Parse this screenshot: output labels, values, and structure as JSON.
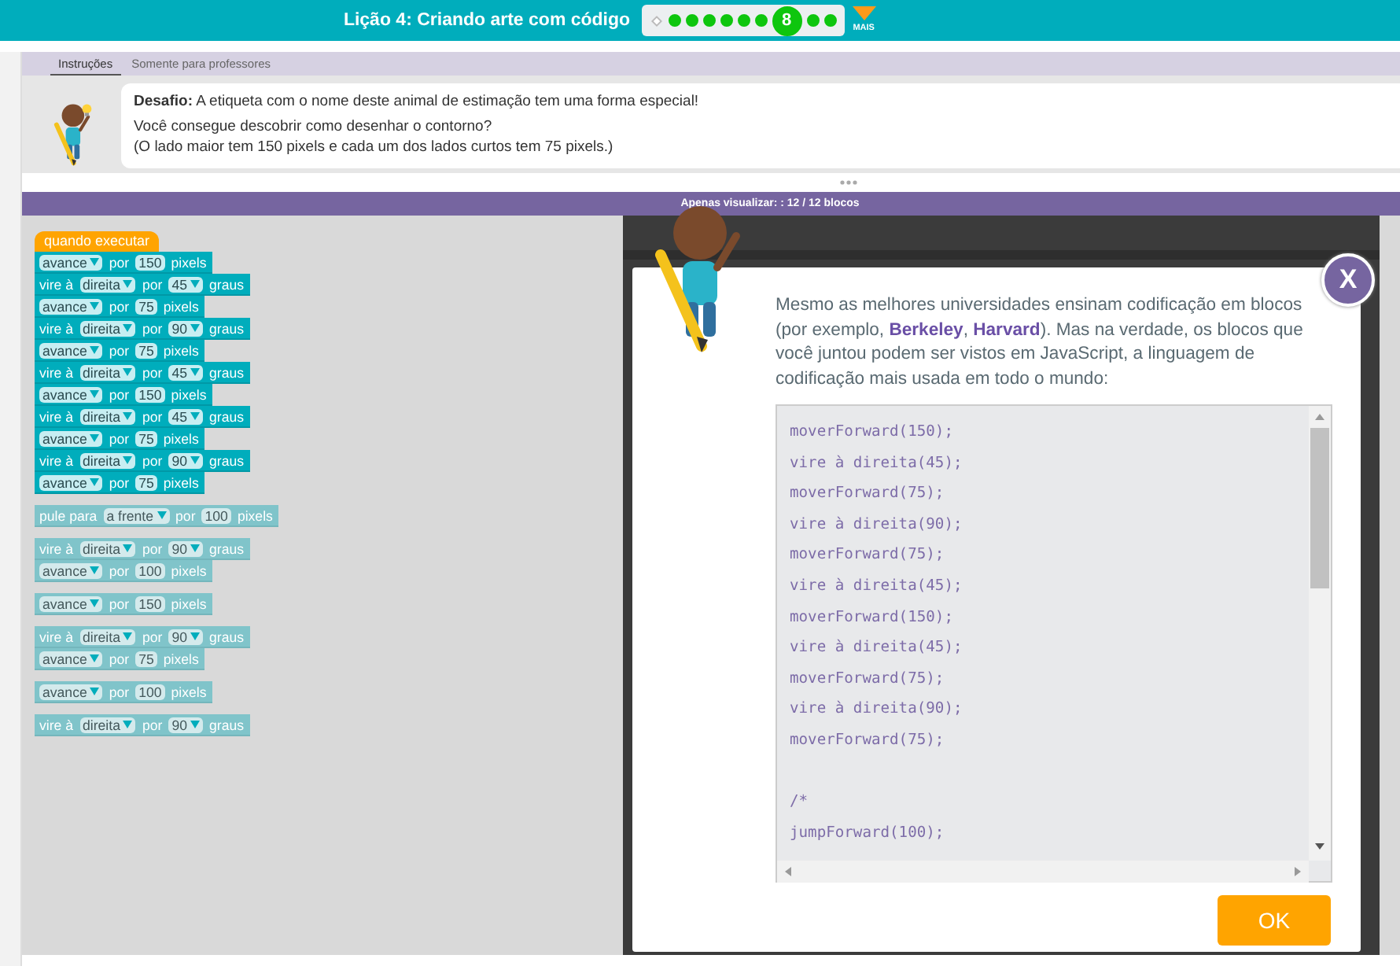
{
  "header": {
    "title": "Lição 4: Criando arte com código",
    "progress": [
      {
        "kind": "diamond",
        "completed": false,
        "selected": false
      },
      {
        "kind": "dot",
        "completed": true,
        "selected": false
      },
      {
        "kind": "dot",
        "completed": true,
        "selected": false
      },
      {
        "kind": "dot",
        "completed": true,
        "selected": false
      },
      {
        "kind": "dot",
        "completed": true,
        "selected": false
      },
      {
        "kind": "dot",
        "completed": true,
        "selected": false
      },
      {
        "kind": "dot",
        "completed": true,
        "selected": false
      },
      {
        "kind": "dot",
        "completed": true,
        "selected": true,
        "label": "8"
      },
      {
        "kind": "dot",
        "completed": true,
        "selected": false
      },
      {
        "kind": "dot",
        "completed": true,
        "selected": false
      }
    ],
    "more_label": "MAIS"
  },
  "instructions": {
    "tabs": [
      {
        "label": "Instruções",
        "selected": true
      },
      {
        "label": "Somente para professores",
        "selected": false
      }
    ],
    "challenge": "**Desafio:** A etiqueta com o nome deste animal de estimação tem uma forma especial!",
    "lines": [
      "Você consegue descobrir como desenhar o contorno?",
      "(O lado maior tem 150 pixels e cada um dos lados curtos tem 75 pixels.)"
    ]
  },
  "workspace_bar": {
    "text": "Apenas visualizar: : 12 / 12 blocos"
  },
  "workspace": {
    "stacks": [
      {
        "enabled": true,
        "hat": "quando executar",
        "blocks": [
          {
            "parts": [
              {
                "kind": "dropdown",
                "text": "avance"
              },
              {
                "kind": "text",
                "text": "por"
              },
              {
                "kind": "number",
                "text": "150"
              },
              {
                "kind": "text",
                "text": "pixels"
              }
            ]
          },
          {
            "parts": [
              {
                "kind": "text",
                "text": "vire à"
              },
              {
                "kind": "dropdown",
                "text": "direita"
              },
              {
                "kind": "text",
                "text": "por"
              },
              {
                "kind": "dropdown",
                "text": "45"
              },
              {
                "kind": "text",
                "text": "graus"
              }
            ]
          },
          {
            "parts": [
              {
                "kind": "dropdown",
                "text": "avance"
              },
              {
                "kind": "text",
                "text": "por"
              },
              {
                "kind": "number",
                "text": "75"
              },
              {
                "kind": "text",
                "text": "pixels"
              }
            ]
          },
          {
            "parts": [
              {
                "kind": "text",
                "text": "vire à"
              },
              {
                "kind": "dropdown",
                "text": "direita"
              },
              {
                "kind": "text",
                "text": "por"
              },
              {
                "kind": "dropdown",
                "text": "90"
              },
              {
                "kind": "text",
                "text": "graus"
              }
            ]
          },
          {
            "parts": [
              {
                "kind": "dropdown",
                "text": "avance"
              },
              {
                "kind": "text",
                "text": "por"
              },
              {
                "kind": "number",
                "text": "75"
              },
              {
                "kind": "text",
                "text": "pixels"
              }
            ]
          },
          {
            "parts": [
              {
                "kind": "text",
                "text": "vire à"
              },
              {
                "kind": "dropdown",
                "text": "direita"
              },
              {
                "kind": "text",
                "text": "por"
              },
              {
                "kind": "dropdown",
                "text": "45"
              },
              {
                "kind": "text",
                "text": "graus"
              }
            ]
          },
          {
            "parts": [
              {
                "kind": "dropdown",
                "text": "avance"
              },
              {
                "kind": "text",
                "text": "por"
              },
              {
                "kind": "number",
                "text": "150"
              },
              {
                "kind": "text",
                "text": "pixels"
              }
            ]
          },
          {
            "parts": [
              {
                "kind": "text",
                "text": "vire à"
              },
              {
                "kind": "dropdown",
                "text": "direita"
              },
              {
                "kind": "text",
                "text": "por"
              },
              {
                "kind": "dropdown",
                "text": "45"
              },
              {
                "kind": "text",
                "text": "graus"
              }
            ]
          },
          {
            "parts": [
              {
                "kind": "dropdown",
                "text": "avance"
              },
              {
                "kind": "text",
                "text": "por"
              },
              {
                "kind": "number",
                "text": "75"
              },
              {
                "kind": "text",
                "text": "pixels"
              }
            ]
          },
          {
            "parts": [
              {
                "kind": "text",
                "text": "vire à"
              },
              {
                "kind": "dropdown",
                "text": "direita"
              },
              {
                "kind": "text",
                "text": "por"
              },
              {
                "kind": "dropdown",
                "text": "90"
              },
              {
                "kind": "text",
                "text": "graus"
              }
            ]
          },
          {
            "parts": [
              {
                "kind": "dropdown",
                "text": "avance"
              },
              {
                "kind": "text",
                "text": "por"
              },
              {
                "kind": "number",
                "text": "75"
              },
              {
                "kind": "text",
                "text": "pixels"
              }
            ]
          }
        ]
      },
      {
        "enabled": false,
        "blocks": [
          {
            "parts": [
              {
                "kind": "text",
                "text": "pule para"
              },
              {
                "kind": "dropdown",
                "text": "a frente"
              },
              {
                "kind": "text",
                "text": "por"
              },
              {
                "kind": "number",
                "text": "100"
              },
              {
                "kind": "text",
                "text": "pixels"
              }
            ]
          }
        ]
      },
      {
        "enabled": false,
        "blocks": [
          {
            "parts": [
              {
                "kind": "text",
                "text": "vire à"
              },
              {
                "kind": "dropdown",
                "text": "direita"
              },
              {
                "kind": "text",
                "text": "por"
              },
              {
                "kind": "dropdown",
                "text": "90"
              },
              {
                "kind": "text",
                "text": "graus"
              }
            ]
          },
          {
            "parts": [
              {
                "kind": "dropdown",
                "text": "avance"
              },
              {
                "kind": "text",
                "text": "por"
              },
              {
                "kind": "number",
                "text": "100"
              },
              {
                "kind": "text",
                "text": "pixels"
              }
            ]
          }
        ]
      },
      {
        "enabled": false,
        "blocks": [
          {
            "parts": [
              {
                "kind": "dropdown",
                "text": "avance"
              },
              {
                "kind": "text",
                "text": "por"
              },
              {
                "kind": "number",
                "text": "150"
              },
              {
                "kind": "text",
                "text": "pixels"
              }
            ]
          }
        ]
      },
      {
        "enabled": false,
        "blocks": [
          {
            "parts": [
              {
                "kind": "text",
                "text": "vire à"
              },
              {
                "kind": "dropdown",
                "text": "direita"
              },
              {
                "kind": "text",
                "text": "por"
              },
              {
                "kind": "dropdown",
                "text": "90"
              },
              {
                "kind": "text",
                "text": "graus"
              }
            ]
          },
          {
            "parts": [
              {
                "kind": "dropdown",
                "text": "avance"
              },
              {
                "kind": "text",
                "text": "por"
              },
              {
                "kind": "number",
                "text": "75"
              },
              {
                "kind": "text",
                "text": "pixels"
              }
            ]
          }
        ]
      },
      {
        "enabled": false,
        "blocks": [
          {
            "parts": [
              {
                "kind": "dropdown",
                "text": "avance"
              },
              {
                "kind": "text",
                "text": "por"
              },
              {
                "kind": "number",
                "text": "100"
              },
              {
                "kind": "text",
                "text": "pixels"
              }
            ]
          }
        ]
      },
      {
        "enabled": false,
        "blocks": [
          {
            "parts": [
              {
                "kind": "text",
                "text": "vire à"
              },
              {
                "kind": "dropdown",
                "text": "direita"
              },
              {
                "kind": "text",
                "text": "por"
              },
              {
                "kind": "dropdown",
                "text": "90"
              },
              {
                "kind": "text",
                "text": "graus"
              }
            ]
          }
        ]
      }
    ]
  },
  "dialog": {
    "close_button": "X",
    "message": [
      {
        "kind": "text",
        "text": "Mesmo as melhores universidades ensinam codificação em blocos (por exemplo, "
      },
      {
        "kind": "link",
        "text": "Berkeley"
      },
      {
        "kind": "text",
        "text": ", "
      },
      {
        "kind": "link",
        "text": "Harvard"
      },
      {
        "kind": "text",
        "text": "). Mas na verdade, os blocos que você juntou podem ser vistos em JavaScript, a linguagem de codificação mais usada em todo o mundo:"
      }
    ],
    "code": [
      {
        "lines": [
          "moverForward(150);",
          "vire à direita(45);",
          "moverForward(75);",
          "vire à direita(90);",
          "moverForward(75);",
          "vire à direita(45);",
          "moverForward(150);",
          "vire à direita(45);",
          "moverForward(75);",
          "vire à direita(90);",
          "moverForward(75);"
        ]
      },
      {
        "lines": [
          "/*",
          "jumpForward(100);"
        ]
      }
    ],
    "ok_button": "OK"
  }
}
